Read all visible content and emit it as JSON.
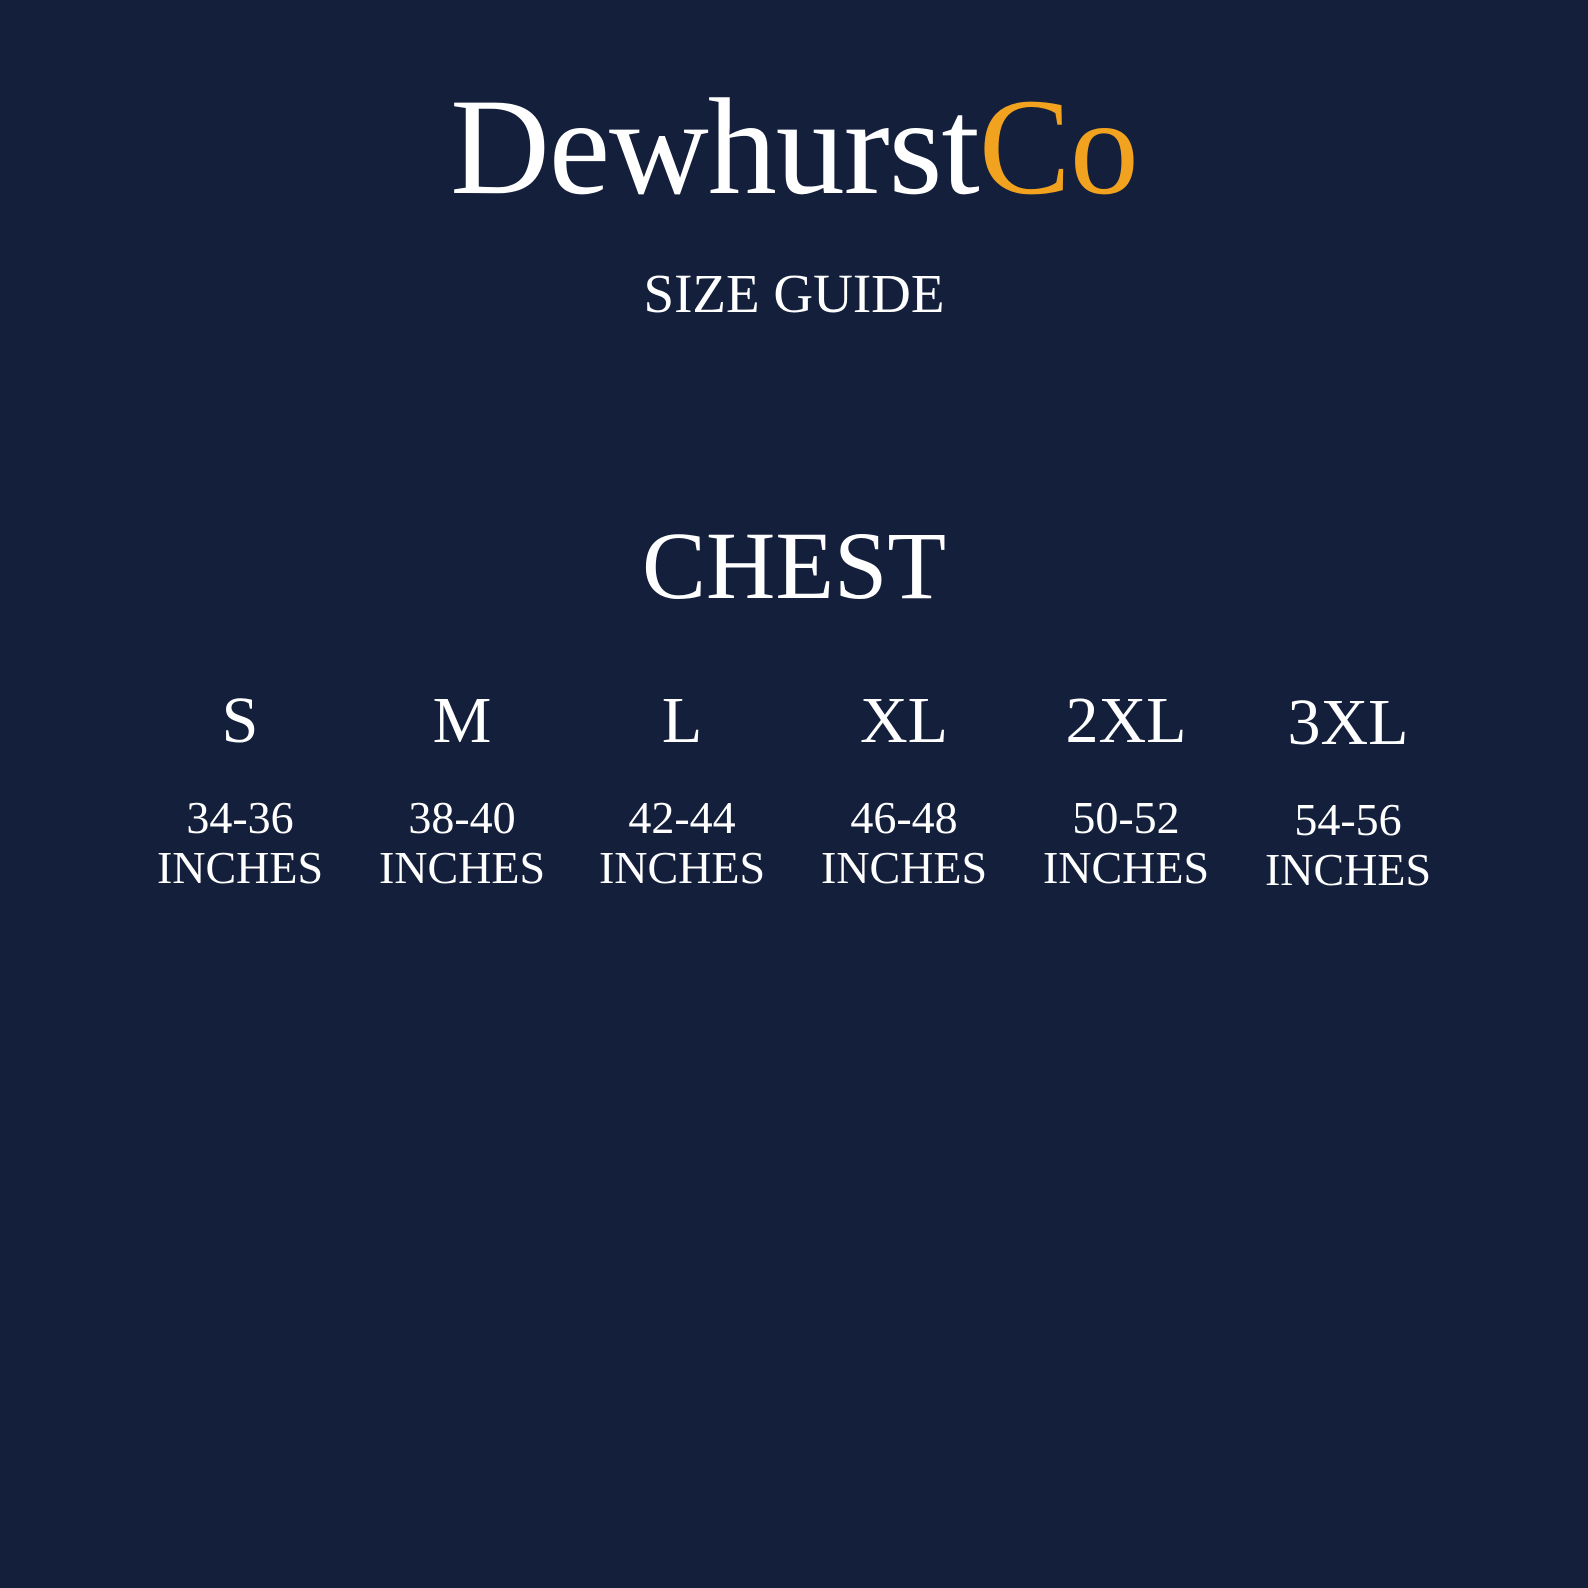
{
  "brand": {
    "name_main": "Dewhurst",
    "name_accent": "Co",
    "accent_color": "#f1a21e"
  },
  "subtitle": "SIZE GUIDE",
  "section_title": "CHEST",
  "sizes": [
    {
      "label": "S",
      "range": "34-36",
      "unit": "INCHES"
    },
    {
      "label": "M",
      "range": "38-40",
      "unit": "INCHES"
    },
    {
      "label": "L",
      "range": "42-44",
      "unit": "INCHES"
    },
    {
      "label": "XL",
      "range": "46-48",
      "unit": "INCHES"
    },
    {
      "label": "2XL",
      "range": "50-52",
      "unit": "INCHES"
    },
    {
      "label": "3XL",
      "range": "54-56",
      "unit": "INCHES"
    }
  ],
  "colors": {
    "background": "#131f3b",
    "text": "#ffffff"
  }
}
